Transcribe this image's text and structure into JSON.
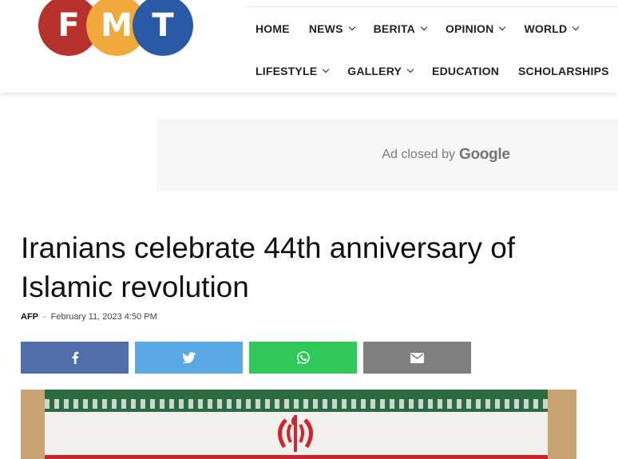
{
  "logo": {
    "letters": [
      "F",
      "M",
      "T"
    ],
    "colors": [
      "#b8322d",
      "#f2a93b",
      "#2a5aa6"
    ]
  },
  "nav": {
    "row1": [
      {
        "label": "HOME",
        "dropdown": false
      },
      {
        "label": "NEWS",
        "dropdown": true
      },
      {
        "label": "BERITA",
        "dropdown": true
      },
      {
        "label": "OPINION",
        "dropdown": true
      },
      {
        "label": "WORLD",
        "dropdown": true
      }
    ],
    "row2": [
      {
        "label": "LIFESTYLE",
        "dropdown": true
      },
      {
        "label": "GALLERY",
        "dropdown": true
      },
      {
        "label": "EDUCATION",
        "dropdown": false
      },
      {
        "label": "SCHOLARSHIPS",
        "dropdown": false
      }
    ]
  },
  "ad": {
    "text": "Ad closed by",
    "brand": "Google"
  },
  "article": {
    "title": "Iranians celebrate 44th anniversary of Islamic revolution",
    "author": "AFP",
    "separator": "-",
    "date": "February 11, 2023 4:50 PM"
  },
  "share": {
    "buttons": [
      {
        "name": "facebook",
        "icon": "facebook-icon",
        "color": "#516eab"
      },
      {
        "name": "twitter",
        "icon": "twitter-icon",
        "color": "#5aa9e4"
      },
      {
        "name": "whatsapp",
        "icon": "whatsapp-icon",
        "color": "#31c85a"
      },
      {
        "name": "email",
        "icon": "email-icon",
        "color": "#808080"
      }
    ]
  }
}
